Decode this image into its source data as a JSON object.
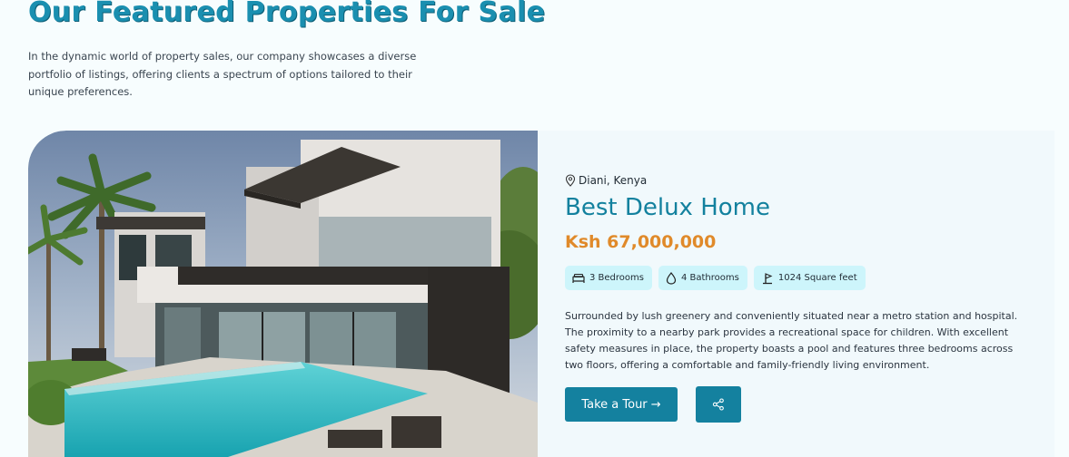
{
  "header": {
    "title": "Our Featured Properties For Sale",
    "intro": "In the dynamic world of property sales, our company showcases a diverse portfolio of listings, offering clients a spectrum of options tailored to their unique preferences."
  },
  "property": {
    "location": "Diani, Kenya",
    "title": "Best Delux Home",
    "price": "Ksh 67,000,000",
    "features": [
      {
        "icon": "bed-icon",
        "label": "3 Bedrooms"
      },
      {
        "icon": "water-drop-icon",
        "label": "4 Bathrooms"
      },
      {
        "icon": "area-icon",
        "label": "1024 Square feet"
      }
    ],
    "description": "Surrounded by lush greenery and conveniently situated near a metro station and hospital. The proximity to a nearby park provides a recreational space for children. With excellent safety measures in place, the property boasts a pool and features three bedrooms across two floors, offering a comfortable and family-friendly living environment.",
    "tour_label": "Take a Tour →",
    "share_icon": "share-icon"
  },
  "colors": {
    "brand": "#14819f",
    "price": "#e08a2a",
    "feature_bg": "#cdf5fb",
    "page_bg": "#f7fdfe"
  }
}
